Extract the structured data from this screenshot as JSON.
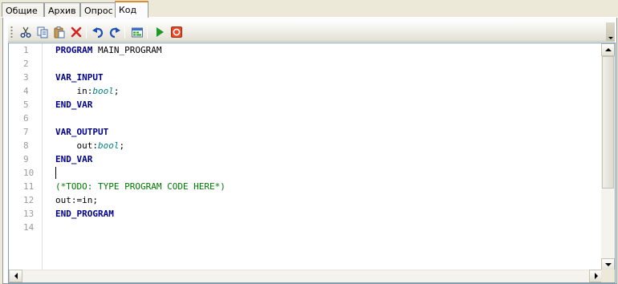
{
  "tabs": [
    {
      "label": "Общие",
      "active": false
    },
    {
      "label": "Архив",
      "active": false
    },
    {
      "label": "Опрос",
      "active": false
    },
    {
      "label": "Код",
      "active": true
    }
  ],
  "toolbar": {
    "buttons": [
      "cut-icon",
      "copy-icon",
      "paste-icon",
      "delete-icon",
      "undo-icon",
      "redo-icon",
      "compile-icon",
      "run-icon",
      "stop-icon"
    ]
  },
  "editor": {
    "line_numbers": [
      "1",
      "2",
      "3",
      "4",
      "5",
      "6",
      "7",
      "8",
      "9",
      "10",
      "11",
      "12",
      "13",
      "14"
    ],
    "lines": [
      {
        "tokens": [
          {
            "t": "PROGRAM",
            "c": "kw"
          },
          {
            "t": " MAIN_PROGRAM",
            "c": "plain"
          }
        ]
      },
      {
        "tokens": []
      },
      {
        "tokens": [
          {
            "t": "VAR_INPUT",
            "c": "kw"
          }
        ]
      },
      {
        "tokens": [
          {
            "t": "    in:",
            "c": "plain"
          },
          {
            "t": "bool",
            "c": "type"
          },
          {
            "t": ";",
            "c": "plain"
          }
        ]
      },
      {
        "tokens": [
          {
            "t": "END_VAR",
            "c": "kw"
          }
        ]
      },
      {
        "tokens": []
      },
      {
        "tokens": [
          {
            "t": "VAR_OUTPUT",
            "c": "kw"
          }
        ]
      },
      {
        "tokens": [
          {
            "t": "    out:",
            "c": "plain"
          },
          {
            "t": "bool",
            "c": "type"
          },
          {
            "t": ";",
            "c": "plain"
          }
        ]
      },
      {
        "tokens": [
          {
            "t": "END_VAR",
            "c": "kw"
          }
        ]
      },
      {
        "tokens": []
      },
      {
        "tokens": [
          {
            "t": "(*TODO: TYPE PROGRAM CODE HERE*)",
            "c": "comment"
          }
        ]
      },
      {
        "tokens": [
          {
            "t": "out:=in;",
            "c": "plain"
          }
        ]
      },
      {
        "tokens": [
          {
            "t": "END_PROGRAM",
            "c": "kw"
          }
        ]
      },
      {
        "tokens": []
      }
    ],
    "caret_line": 10
  },
  "colors": {
    "keyword": "#00008b",
    "type": "#008080",
    "comment": "#007a00",
    "active_tab_accent": "#e68b2c"
  }
}
